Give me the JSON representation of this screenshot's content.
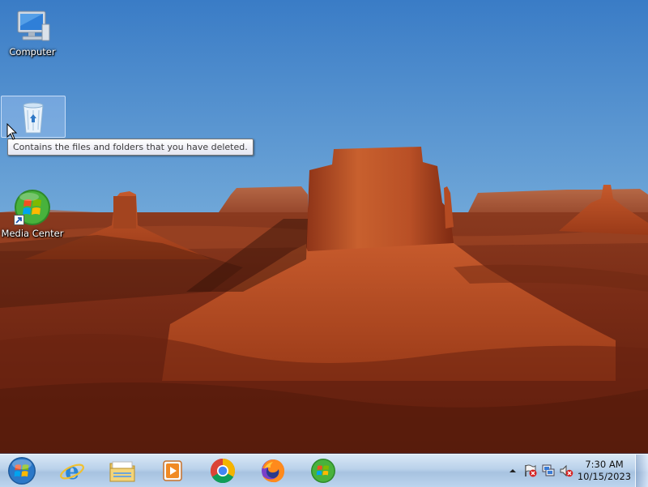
{
  "desktop": {
    "icons": [
      {
        "label": "Computer",
        "icon": "computer-icon"
      },
      {
        "label": "",
        "icon": "recycle-bin-icon",
        "selected": true
      },
      {
        "label": "Media Center",
        "icon": "media-center-icon",
        "shortcut": true
      }
    ],
    "tooltip": "Contains the files and folders that you have deleted."
  },
  "taskbar": {
    "start": "start-orb-icon",
    "pinned": [
      {
        "name": "internet-explorer-icon"
      },
      {
        "name": "file-explorer-icon"
      },
      {
        "name": "media-player-icon"
      },
      {
        "name": "chrome-icon"
      },
      {
        "name": "firefox-icon"
      },
      {
        "name": "windows-media-center-icon"
      }
    ],
    "tray": {
      "icons": [
        "show-hidden-icons-chevron",
        "action-center-flag-icon",
        "network-icon",
        "volume-muted-icon"
      ],
      "time": "7:30 AM",
      "date": "10/15/2023"
    }
  },
  "colors": {
    "sky_top": "#3f82c9",
    "sky_horizon": "#bcd6e8",
    "rock": "#b4502a",
    "taskbar": "#bcd4ee"
  }
}
